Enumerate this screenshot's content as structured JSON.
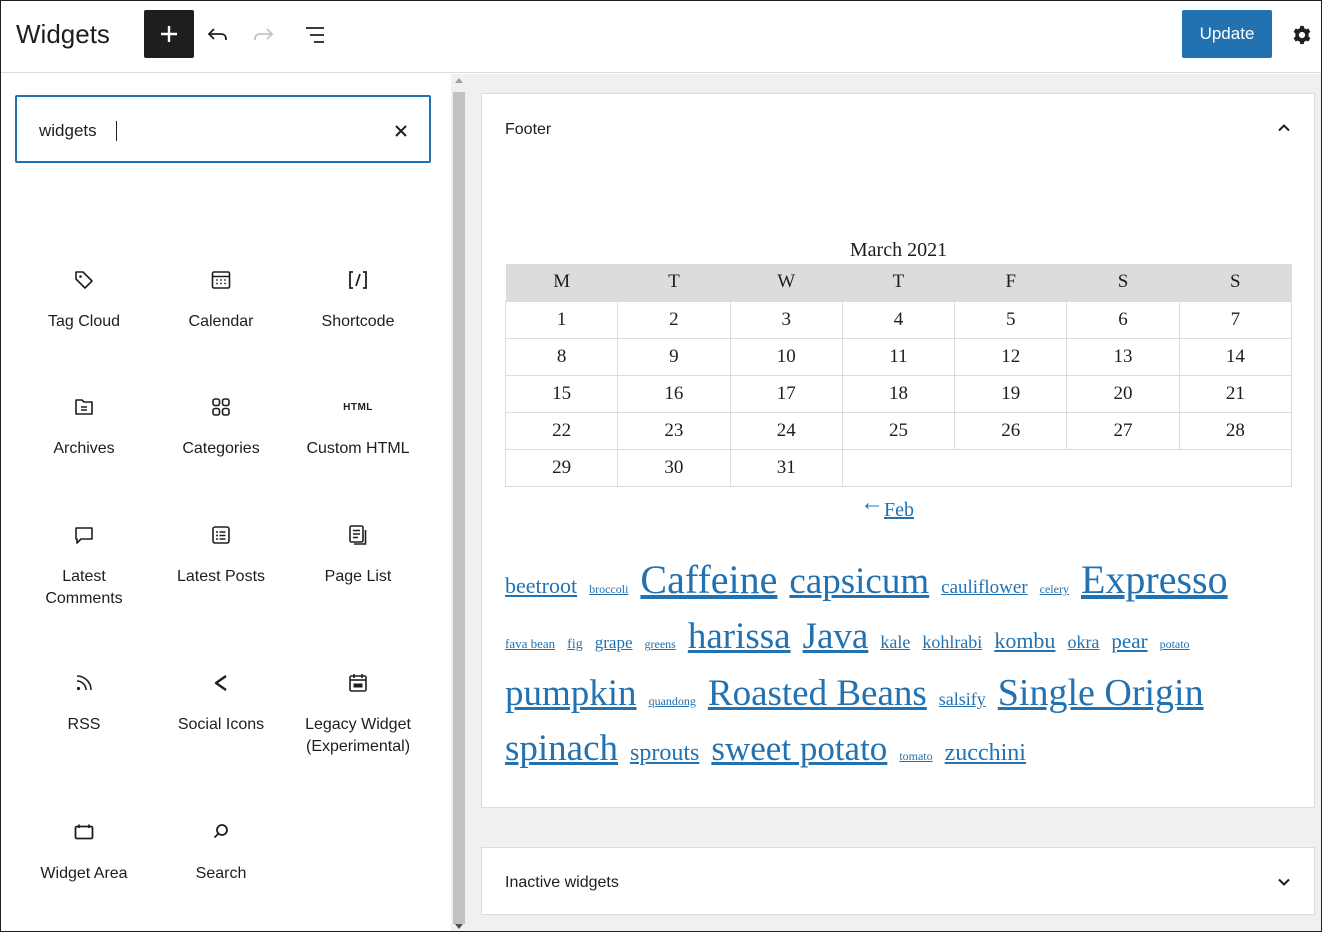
{
  "header": {
    "title": "Widgets",
    "update_label": "Update",
    "icons": {
      "add": "plus-icon",
      "undo": "undo-icon",
      "redo": "redo-icon",
      "outline": "list-view-icon",
      "settings": "gear-icon"
    }
  },
  "inserter": {
    "search_value": "widgets",
    "clear_icon": "close-icon",
    "blocks": [
      {
        "label": "Tag Cloud",
        "icon": "tag-icon"
      },
      {
        "label": "Calendar",
        "icon": "calendar-icon"
      },
      {
        "label": "Shortcode",
        "icon": "shortcode-icon"
      },
      {
        "label": "Archives",
        "icon": "archive-icon"
      },
      {
        "label": "Categories",
        "icon": "categories-icon"
      },
      {
        "label": "Custom HTML",
        "icon": "html-icon",
        "icon_text": "HTML"
      },
      {
        "label": "Latest\nComments",
        "icon": "comment-icon"
      },
      {
        "label": "Latest Posts",
        "icon": "post-list-icon"
      },
      {
        "label": "Page List",
        "icon": "page-list-icon"
      },
      {
        "label": "RSS",
        "icon": "rss-icon"
      },
      {
        "label": "Social Icons",
        "icon": "share-icon"
      },
      {
        "label": "Legacy Widget\n(Experimental)",
        "icon": "widget-icon"
      },
      {
        "label": "Widget Area",
        "icon": "widget-area-icon"
      },
      {
        "label": "Search",
        "icon": "search-icon"
      }
    ]
  },
  "footer_area": {
    "title": "Footer",
    "toggle_icon": "chevron-up-icon",
    "calendar": {
      "caption": "March 2021",
      "weekdays": [
        "M",
        "T",
        "W",
        "T",
        "F",
        "S",
        "S"
      ],
      "weeks": [
        [
          "1",
          "2",
          "3",
          "4",
          "5",
          "6",
          "7"
        ],
        [
          "8",
          "9",
          "10",
          "11",
          "12",
          "13",
          "14"
        ],
        [
          "15",
          "16",
          "17",
          "18",
          "19",
          "20",
          "21"
        ],
        [
          "22",
          "23",
          "24",
          "25",
          "26",
          "27",
          "28"
        ],
        [
          "29",
          "30",
          "31"
        ]
      ],
      "prev_arrow": "←",
      "prev_label": "Feb"
    },
    "tag_cloud": [
      {
        "tag": "beetroot",
        "size": 22
      },
      {
        "tag": "broccoli",
        "size": 12
      },
      {
        "tag": "Caffeine",
        "size": 40
      },
      {
        "tag": "capsicum",
        "size": 37
      },
      {
        "tag": "cauliflower",
        "size": 19
      },
      {
        "tag": "celery",
        "size": 12
      },
      {
        "tag": "Expresso",
        "size": 40
      },
      {
        "tag": "fava bean",
        "size": 13
      },
      {
        "tag": "fig",
        "size": 14
      },
      {
        "tag": "grape",
        "size": 17
      },
      {
        "tag": "greens",
        "size": 12
      },
      {
        "tag": "harissa",
        "size": 37
      },
      {
        "tag": "Java",
        "size": 37
      },
      {
        "tag": "kale",
        "size": 18
      },
      {
        "tag": "kohlrabi",
        "size": 18
      },
      {
        "tag": "kombu",
        "size": 22
      },
      {
        "tag": "okra",
        "size": 18
      },
      {
        "tag": "pear",
        "size": 21
      },
      {
        "tag": "potato",
        "size": 12
      },
      {
        "tag": "pumpkin",
        "size": 37
      },
      {
        "tag": "quandong",
        "size": 12
      },
      {
        "tag": "Roasted Beans",
        "size": 37
      },
      {
        "tag": "salsify",
        "size": 18
      },
      {
        "tag": "Single Origin",
        "size": 38
      },
      {
        "tag": "spinach",
        "size": 37
      },
      {
        "tag": "sprouts",
        "size": 24
      },
      {
        "tag": "sweet potato",
        "size": 35
      },
      {
        "tag": "tomato",
        "size": 12
      },
      {
        "tag": "zucchini",
        "size": 24
      }
    ]
  },
  "inactive_area": {
    "title": "Inactive widgets",
    "toggle_icon": "chevron-down-icon"
  },
  "colors": {
    "accent": "#2271b1",
    "dark": "#1e1e1e",
    "canvas": "#f0f0f1",
    "border": "#dcdcde"
  }
}
